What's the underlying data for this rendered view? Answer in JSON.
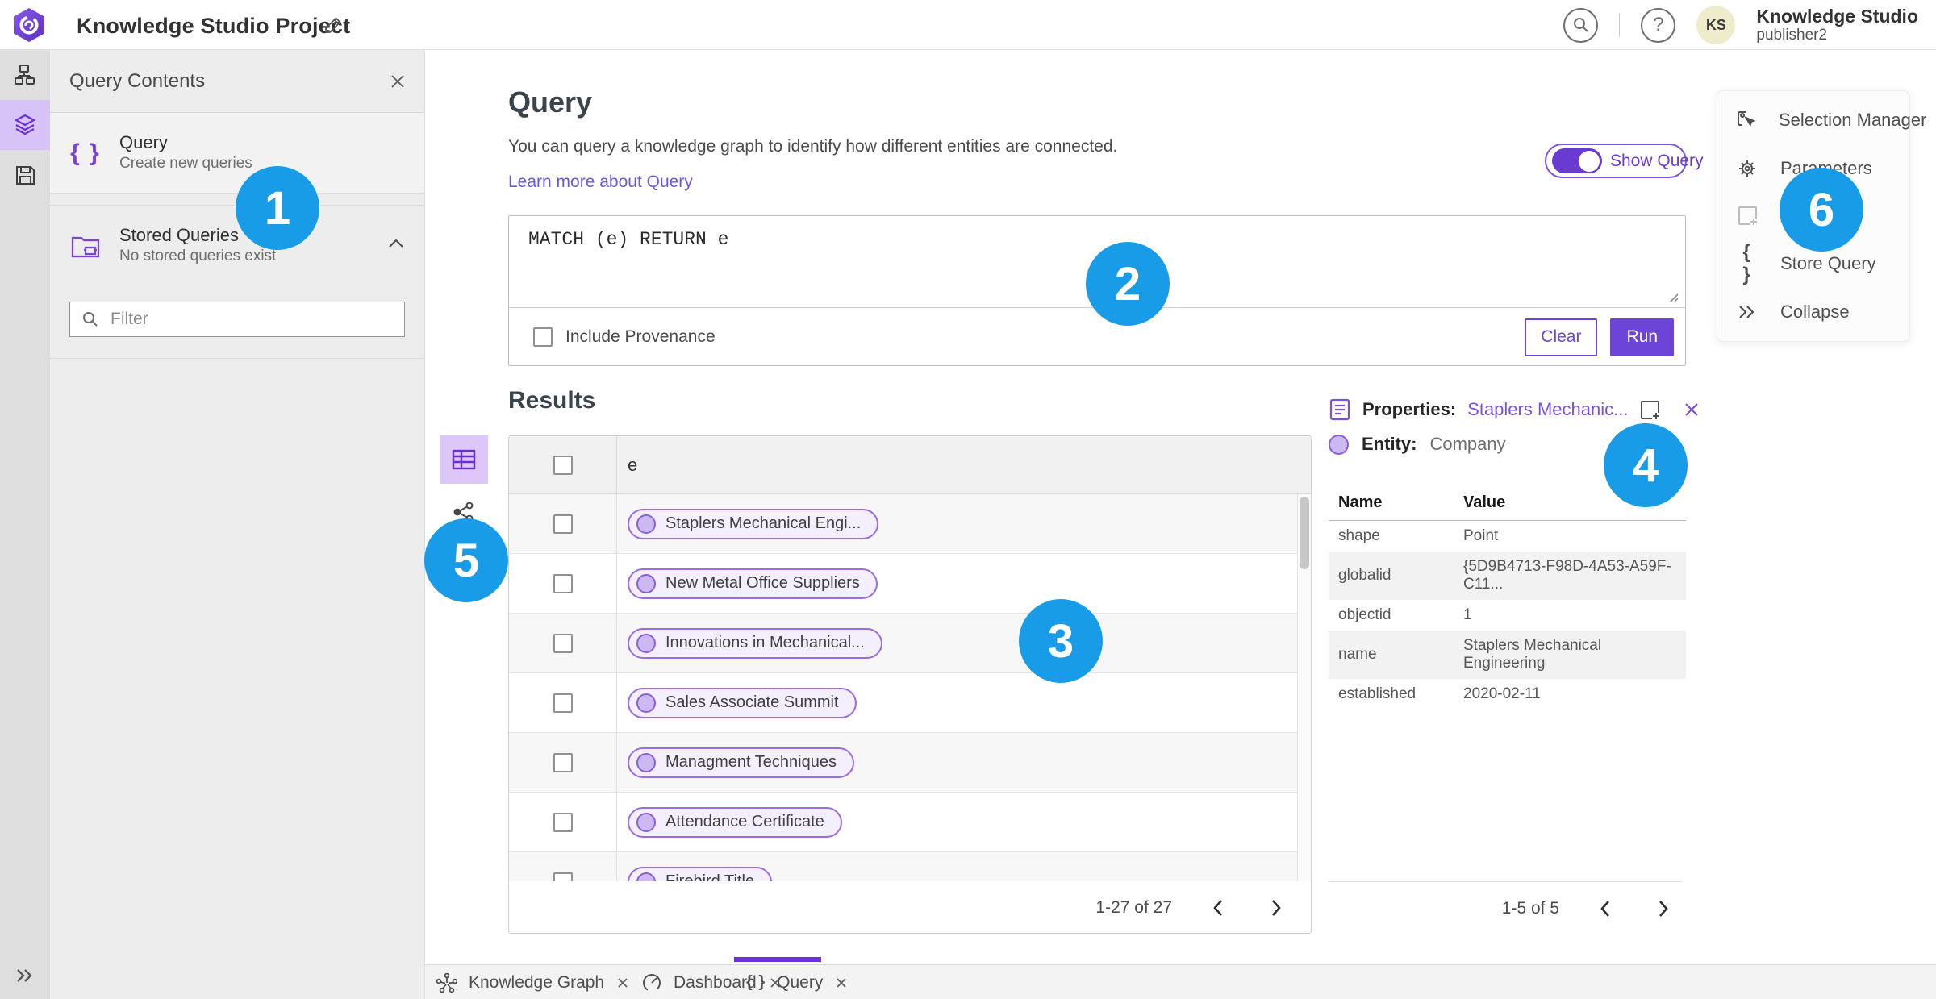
{
  "topbar": {
    "title": "Knowledge Studio Project",
    "user_name": "Knowledge Studio",
    "user_role": "publisher2",
    "avatar_initials": "KS"
  },
  "contents_panel": {
    "title": "Query Contents",
    "query_item": {
      "title": "Query",
      "subtitle": "Create new queries"
    },
    "stored_item": {
      "title": "Stored Queries",
      "subtitle": "No stored queries exist"
    },
    "filter_placeholder": "Filter"
  },
  "query_section": {
    "heading": "Query",
    "description": "You can query a knowledge graph to identify how different entities are connected.",
    "learn_more": "Learn more about Query",
    "show_query_label": "Show Query",
    "query_text": "MATCH (e) RETURN e",
    "include_provenance_label": "Include Provenance",
    "clear_label": "Clear",
    "run_label": "Run"
  },
  "results": {
    "heading": "Results",
    "column": "e",
    "rows": [
      "Staplers Mechanical Engi...",
      "New Metal Office Suppliers",
      "Innovations in Mechanical...",
      "Sales Associate Summit",
      "Managment Techniques",
      "Attendance Certificate",
      "Firebird Title"
    ],
    "pagination": "1-27 of 27"
  },
  "properties_panel": {
    "label": "Properties:",
    "title": "Staplers Mechanic...",
    "entity_label": "Entity:",
    "entity_type": "Company",
    "columns": {
      "name": "Name",
      "value": "Value"
    },
    "rows": [
      {
        "name": "shape",
        "value": "Point"
      },
      {
        "name": "globalid",
        "value": "{5D9B4713-F98D-4A53-A59F-C11..."
      },
      {
        "name": "objectid",
        "value": "1"
      },
      {
        "name": "name",
        "value": "Staplers Mechanical Engineering"
      },
      {
        "name": "established",
        "value": "2020-02-11"
      }
    ],
    "pagination": "1-5 of 5"
  },
  "tools_menu": {
    "items": [
      {
        "label": "Selection Manager"
      },
      {
        "label": "Parameters"
      },
      {
        "label": "Add"
      },
      {
        "label": "Store Query"
      },
      {
        "label": "Collapse"
      }
    ]
  },
  "bottom_tabs": {
    "tabs": [
      {
        "label": "Knowledge Graph"
      },
      {
        "label": "Dashboard"
      },
      {
        "label": "Query"
      }
    ]
  },
  "glyphs": {
    "braces": "{ }"
  },
  "annotations": [
    {
      "number": "1"
    },
    {
      "number": "2"
    },
    {
      "number": "3"
    },
    {
      "number": "4"
    },
    {
      "number": "5"
    },
    {
      "number": "6"
    }
  ],
  "colors": {
    "accent_purple": "#6c44d8",
    "light_purple": "#dcc7f8",
    "annotation_blue": "#189ce8",
    "link_purple": "#685ae0",
    "avatar_yellow": "#efeccb"
  }
}
